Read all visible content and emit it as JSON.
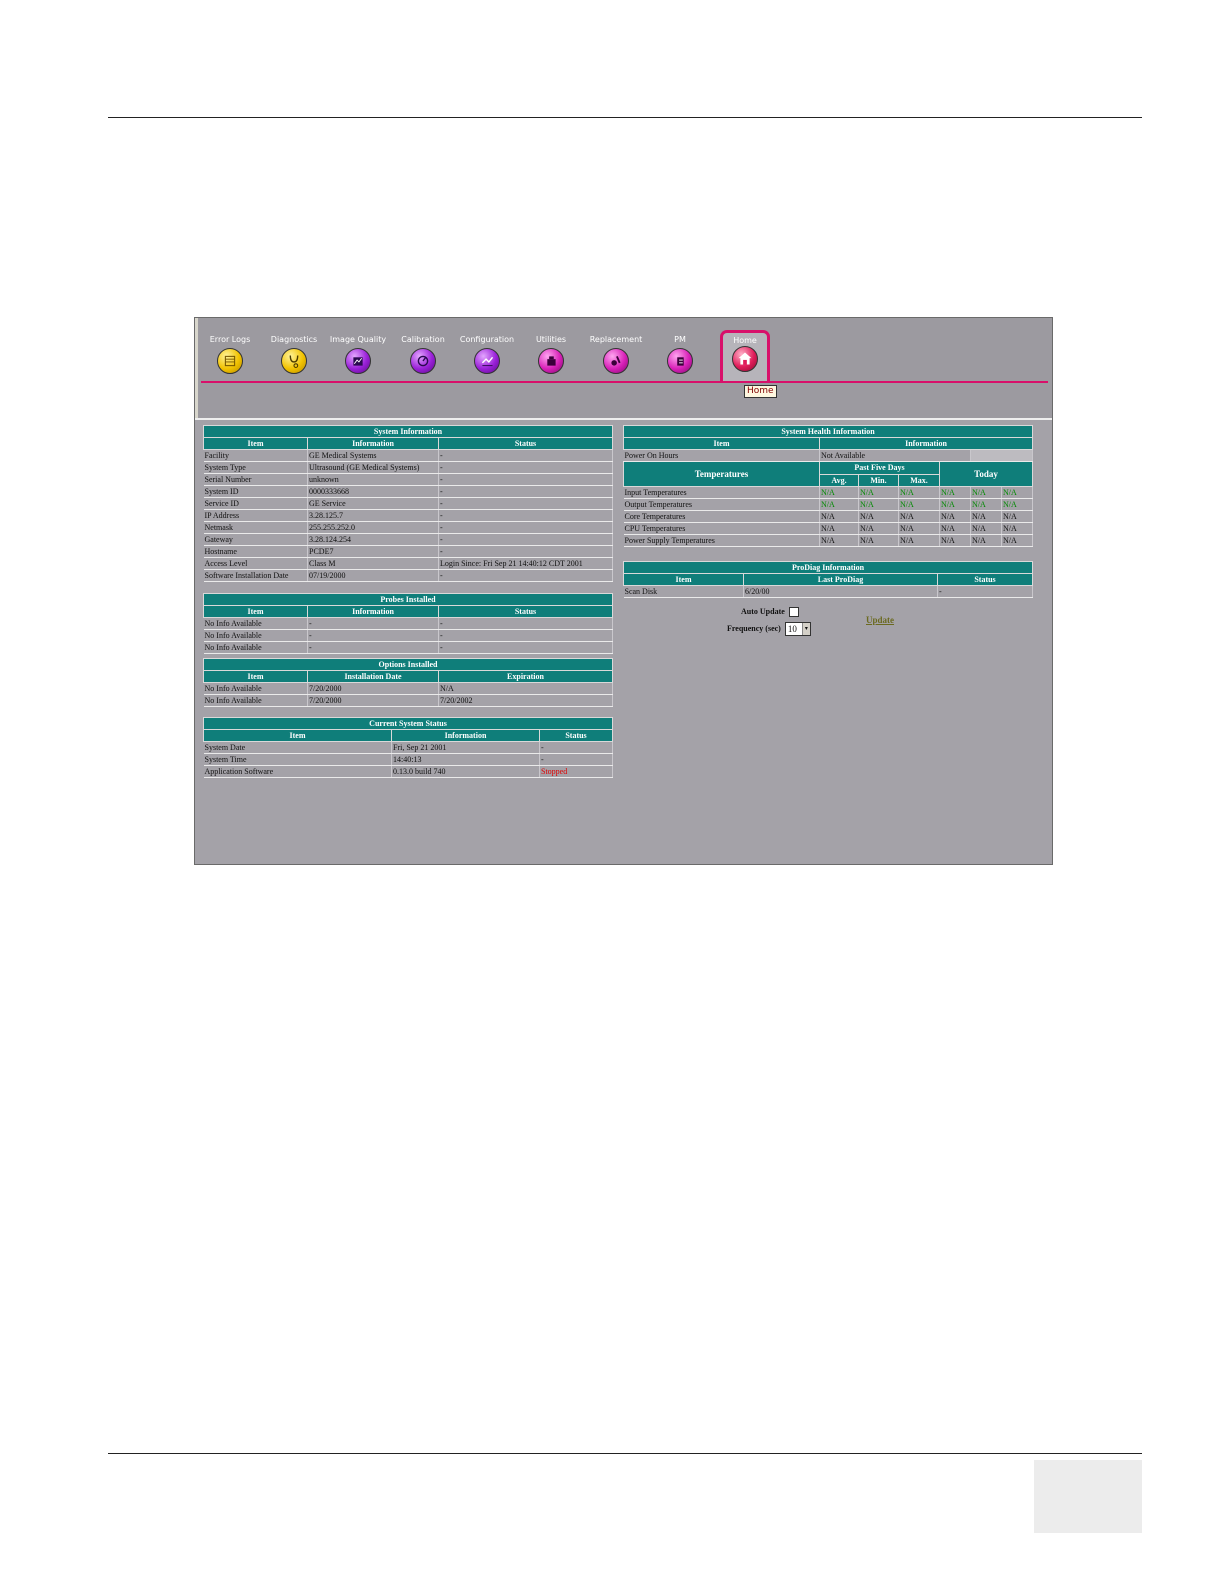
{
  "toolbar": {
    "tools": [
      {
        "label": "Error Logs",
        "icon": "error-logs-icon",
        "color": "#f2c200"
      },
      {
        "label": "Diagnostics",
        "icon": "stethoscope-icon",
        "color": "#f2c200"
      },
      {
        "label": "Image Quality",
        "icon": "image-quality-icon",
        "color": "#9a20d8"
      },
      {
        "label": "Calibration",
        "icon": "calibration-icon",
        "color": "#9a20d8"
      },
      {
        "label": "Configuration",
        "icon": "configuration-icon",
        "color": "#9a20d8"
      },
      {
        "label": "Utilities",
        "icon": "utilities-icon",
        "color": "#d820b8"
      },
      {
        "label": "Replacement",
        "icon": "replacement-icon",
        "color": "#d820b8"
      },
      {
        "label": "PM",
        "icon": "pm-icon",
        "color": "#d820b8"
      }
    ],
    "home": {
      "label": "Home",
      "icon": "home-icon",
      "tooltip": "Home",
      "accent": "#d8106a"
    }
  },
  "system_info": {
    "title": "System Information",
    "headers": [
      "Item",
      "Information",
      "Status"
    ],
    "rows": [
      [
        "Facility",
        "GE Medical Systems",
        "-"
      ],
      [
        "System Type",
        "Ultrasound (GE Medical Systems)",
        "-"
      ],
      [
        "Serial Number",
        "unknown",
        "-"
      ],
      [
        "System ID",
        "0000333668",
        "-"
      ],
      [
        "Service ID",
        "GE Service",
        "-"
      ],
      [
        "IP Address",
        "3.28.125.7",
        "-"
      ],
      [
        "Netmask",
        "255.255.252.0",
        "-"
      ],
      [
        "Gateway",
        "3.28.124.254",
        "-"
      ],
      [
        "Hostname",
        "PCDE7",
        "-"
      ],
      [
        "Access Level",
        "Class M",
        "Login Since: Fri Sep 21 14:40:12 CDT 2001"
      ],
      [
        "Software Installation Date",
        "07/19/2000",
        "-"
      ]
    ]
  },
  "probes": {
    "title": "Probes Installed",
    "headers": [
      "Item",
      "Information",
      "Status"
    ],
    "rows": [
      [
        "No Info Available",
        "-",
        "-"
      ],
      [
        "No Info Available",
        "-",
        "-"
      ],
      [
        "No Info Available",
        "-",
        "-"
      ]
    ]
  },
  "options": {
    "title": "Options Installed",
    "headers": [
      "Item",
      "Installation Date",
      "Expiration"
    ],
    "rows": [
      [
        "No Info Available",
        "7/20/2000",
        "N/A"
      ],
      [
        "No Info Available",
        "7/20/2000",
        "7/20/2002"
      ]
    ]
  },
  "current_status": {
    "title": "Current System Status",
    "headers": [
      "Item",
      "Information",
      "Status"
    ],
    "rows": [
      [
        "System Date",
        "Fri, Sep 21 2001",
        "-"
      ],
      [
        "System Time",
        "14:40:13",
        "-"
      ],
      [
        "Application Software",
        "0.13.0 build 740",
        "Stopped"
      ]
    ]
  },
  "health": {
    "title": "System Health Information",
    "headers": [
      "Item",
      "Information"
    ],
    "power_row": [
      "Power On Hours",
      "Not Available"
    ],
    "temp_header": "Temperatures",
    "past_five_days": "Past Five Days",
    "today": "Today",
    "subheaders": [
      "Avg.",
      "Min.",
      "Max."
    ],
    "temp_rows": [
      {
        "label": "Input Temperatures",
        "values": [
          "N/A",
          "N/A",
          "N/A",
          "N/A",
          "N/A",
          "N/A"
        ],
        "highlight": true
      },
      {
        "label": "Output Temperatures",
        "values": [
          "N/A",
          "N/A",
          "N/A",
          "N/A",
          "N/A",
          "N/A"
        ],
        "highlight": true
      },
      {
        "label": "Core Temperatures",
        "values": [
          "N/A",
          "N/A",
          "N/A",
          "N/A",
          "N/A",
          "N/A"
        ],
        "highlight": false
      },
      {
        "label": "CPU Temperatures",
        "values": [
          "N/A",
          "N/A",
          "N/A",
          "N/A",
          "N/A",
          "N/A"
        ],
        "highlight": false
      },
      {
        "label": "Power Supply Temperatures",
        "values": [
          "N/A",
          "N/A",
          "N/A",
          "N/A",
          "N/A",
          "N/A"
        ],
        "highlight": false
      }
    ]
  },
  "prodiag": {
    "title": "ProDiag Information",
    "headers": [
      "Item",
      "Last ProDiag",
      "Status"
    ],
    "rows": [
      [
        "Scan Disk",
        "6/20/00",
        "-"
      ]
    ]
  },
  "controls": {
    "auto_update_label": "Auto Update",
    "auto_update_checked": false,
    "frequency_label": "Frequency (sec)",
    "frequency_value": "10",
    "update_link": "Update"
  },
  "colors": {
    "header_teal": "#0f7e7a",
    "stopped_red": "#e00000",
    "na_green": "#008a00"
  }
}
